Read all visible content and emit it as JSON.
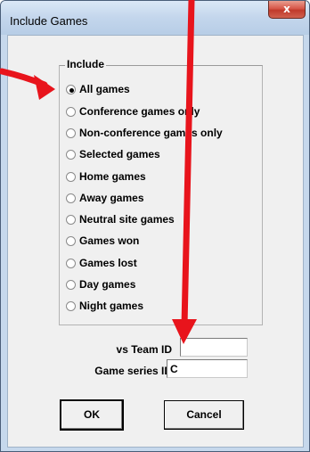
{
  "window": {
    "title": "Include Games",
    "close_label": "x"
  },
  "group": {
    "legend": "Include",
    "options": [
      {
        "label": "All games",
        "checked": true
      },
      {
        "label": "Conference games only",
        "checked": false
      },
      {
        "label": "Non-conference games only",
        "checked": false
      },
      {
        "label": "Selected games",
        "checked": false
      },
      {
        "label": "Home games",
        "checked": false
      },
      {
        "label": "Away games",
        "checked": false
      },
      {
        "label": "Neutral site games",
        "checked": false
      },
      {
        "label": "Games won",
        "checked": false
      },
      {
        "label": "Games lost",
        "checked": false
      },
      {
        "label": "Day games",
        "checked": false
      },
      {
        "label": "Night games",
        "checked": false
      }
    ]
  },
  "fields": {
    "vs_team_label": "vs Team ID",
    "vs_team_value": "",
    "game_series_label": "Game series ID",
    "game_series_value": "C"
  },
  "buttons": {
    "ok": "OK",
    "cancel": "Cancel"
  },
  "annotations": {
    "arrow_color": "#e8141c"
  }
}
